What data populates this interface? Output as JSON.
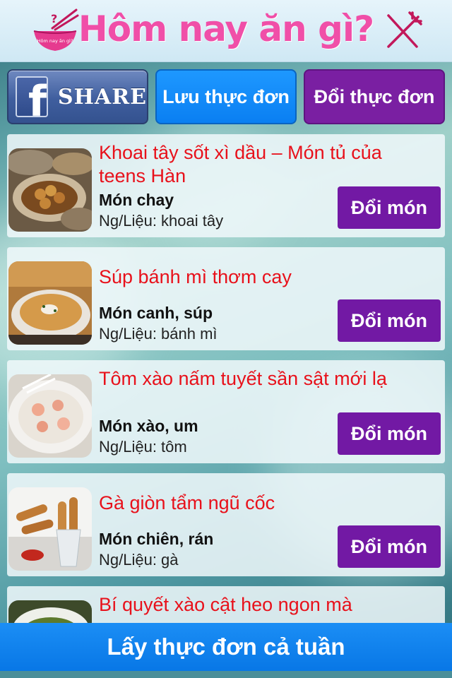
{
  "header": {
    "title": "Hôm nay ăn gì?",
    "logo_text": "Hôm nay ăn gì?",
    "logo_icon": "rice-bowl-chopsticks-icon",
    "menu_icon": "fork-knife-icon"
  },
  "toolbar": {
    "share_label": "SHARE",
    "share_icon": "facebook-icon",
    "save_label": "Lưu thực đơn",
    "change_menu_label": "Đổi thực đơn"
  },
  "dishes": [
    {
      "name": "Khoai tây sốt xì dầu – Món tủ của teens Hàn",
      "category": "Món chay",
      "ingredient": "Ng/Liệu: khoai tây",
      "button": "Đổi món",
      "thumb": "glazed-potatoes-photo"
    },
    {
      "name": "Súp bánh mì thơm cay",
      "category": "Món canh, súp",
      "ingredient": "Ng/Liệu: bánh mì",
      "button": "Đổi món",
      "thumb": "bread-soup-photo"
    },
    {
      "name": "Tôm xào nấm tuyết sần sật mới lạ",
      "category": "Món xào, um",
      "ingredient": "Ng/Liệu: tôm",
      "button": "Đổi món",
      "thumb": "shrimp-fungus-photo"
    },
    {
      "name": "Gà giòn tẩm ngũ cốc",
      "category": "Món chiên, rán",
      "ingredient": "Ng/Liệu: gà",
      "button": "Đổi món",
      "thumb": "crispy-chicken-photo"
    },
    {
      "name": "Bí quyết xào cật heo ngon mà",
      "category": "",
      "ingredient": "",
      "button": "",
      "thumb": "pork-kidney-photo"
    }
  ],
  "footer": {
    "week_button": "Lấy thực đơn cả tuần"
  },
  "colors": {
    "title_pink": "#f04fa8",
    "dish_red": "#e8111b",
    "purple": "#7219a4",
    "blue": "#0a7ff2"
  }
}
